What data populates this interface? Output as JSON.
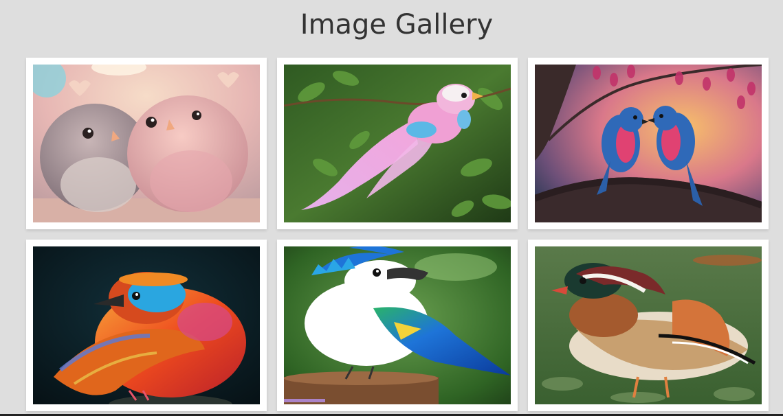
{
  "page": {
    "title": "Image Gallery"
  },
  "gallery": {
    "images": [
      {
        "icon": "cute-lovebirds-image",
        "accent": "#f2c6c0"
      },
      {
        "icon": "pink-bird-on-branch-image",
        "accent": "#e8a6d8"
      },
      {
        "icon": "bluebirds-on-branch-image",
        "accent": "#2a6fb0"
      },
      {
        "icon": "colorful-finch-image",
        "accent": "#f05a1e"
      },
      {
        "icon": "blue-jay-bird-image",
        "accent": "#1e7ad8"
      },
      {
        "icon": "mandarin-duck-image",
        "accent": "#b7703a"
      }
    ]
  }
}
